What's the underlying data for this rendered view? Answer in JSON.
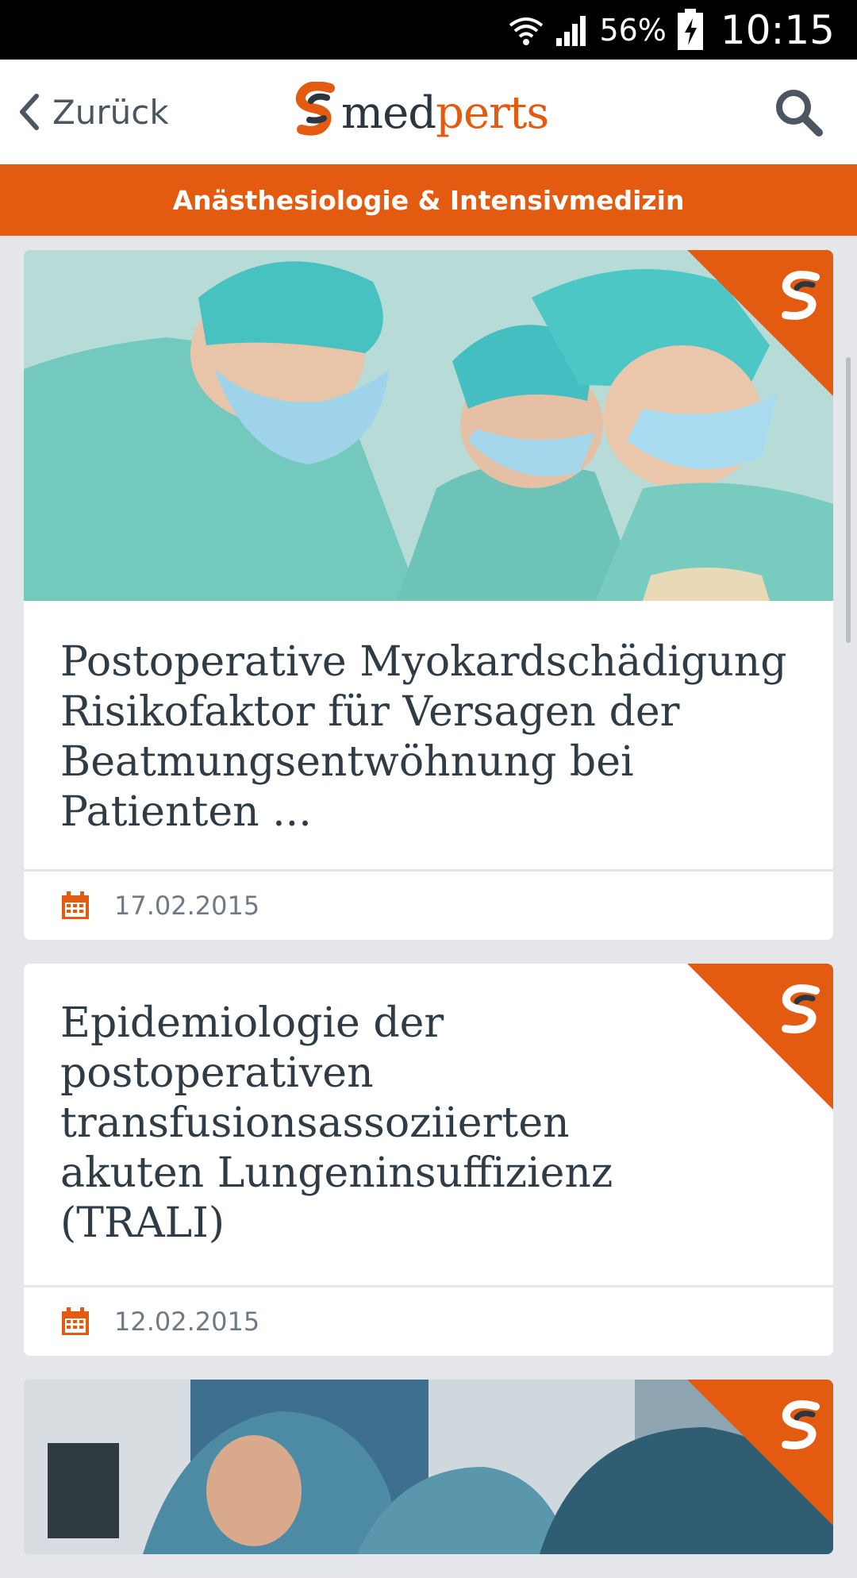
{
  "status": {
    "battery_percent": "56%",
    "time": "10:15"
  },
  "header": {
    "back_label": "Zurück",
    "logo_med": "med",
    "logo_perts": "perts",
    "search_icon": "search-icon"
  },
  "category": {
    "label": "Anästhesiologie & Intensivmedizin"
  },
  "articles": [
    {
      "title": "Postoperative Myokardschädigung Risikofaktor für Versagen der Beatmungsentwöhnung bei Patienten ...",
      "date": "17.02.2015",
      "has_image": true
    },
    {
      "title": "Epidemiologie der postoperativen transfusionsassoziierten akuten Lungeninsuffizienz (TRALI)",
      "date": "12.02.2015",
      "has_image": false
    },
    {
      "has_image": true
    }
  ],
  "colors": {
    "accent": "#e35b10",
    "text": "#2f3b45",
    "background": "#e4e6e9"
  }
}
